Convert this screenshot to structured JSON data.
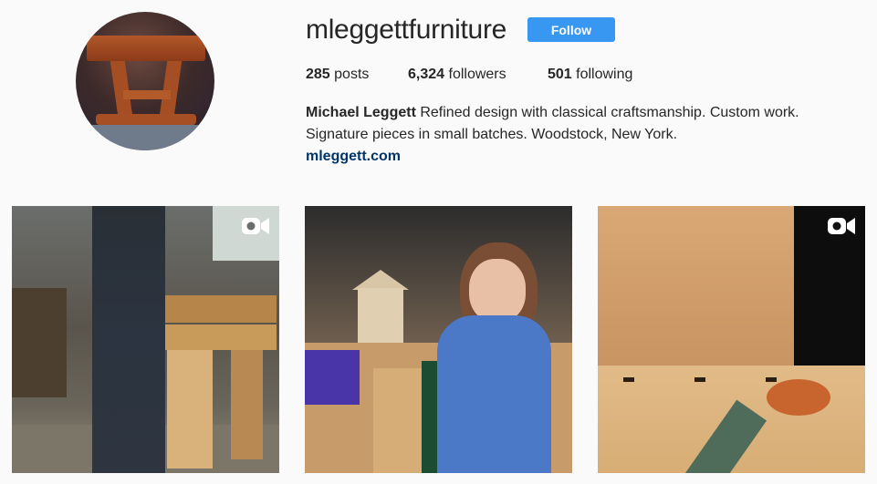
{
  "profile": {
    "username": "mleggettfurniture",
    "follow_label": "Follow",
    "stats": {
      "posts_count": "285",
      "posts_label": " posts",
      "followers_count": "6,324",
      "followers_label": " followers",
      "following_count": "501",
      "following_label": " following"
    },
    "bio": {
      "name": "Michael Leggett",
      "text": " Refined design with classical craftsmanship. Custom work. Signature pieces in small batches. Woodstock, New York.",
      "link": "mleggett.com"
    }
  },
  "posts": [
    {
      "type": "video",
      "icon": "video-camera-icon"
    },
    {
      "type": "photo"
    },
    {
      "type": "video",
      "icon": "video-camera-icon"
    }
  ],
  "colors": {
    "accent": "#3897f0",
    "link": "#003569",
    "text": "#262626",
    "background": "#fafafa"
  }
}
